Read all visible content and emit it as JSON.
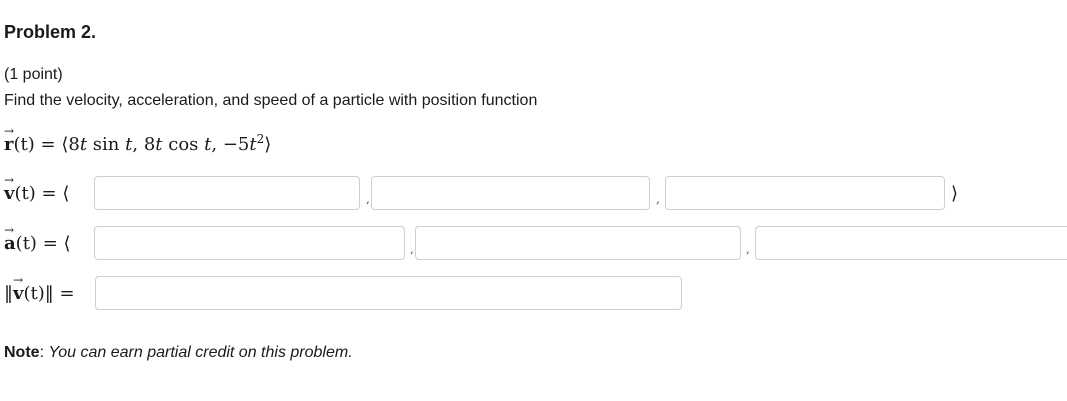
{
  "problem": {
    "title": "Problem 2.",
    "points": "(1 point)",
    "prompt": "Find the velocity, acceleration, and speed of a particle with position function"
  },
  "position": {
    "r": "r",
    "arg": "(t)",
    "eq": "=",
    "open": "⟨",
    "c1_coef": "8",
    "c1_var": "t",
    "c1_fn": "sin",
    "c1_arg": "t",
    "sep": ",",
    "c2_coef": "8",
    "c2_var": "t",
    "c2_fn": "cos",
    "c2_arg": "t",
    "c3_coef": "−5",
    "c3_var": "t",
    "c3_exp": "2",
    "close": "⟩"
  },
  "velocity": {
    "symbol": "v",
    "arg": "(t)",
    "eq": "=",
    "open": "⟨",
    "sep1": ",",
    "sep2": ",",
    "close": "⟩",
    "answers": [
      "",
      "",
      ""
    ]
  },
  "acceleration": {
    "symbol": "a",
    "arg": "(t)",
    "eq": "=",
    "open": "⟨",
    "sep1": ",",
    "sep2": ",",
    "answers": [
      "",
      "",
      ""
    ]
  },
  "speed": {
    "bars_open": "‖",
    "symbol": "v",
    "arg": "(t)",
    "bars_close": "‖",
    "eq": "=",
    "answer": ""
  },
  "note": {
    "label": "Note",
    "colon": ":",
    "text": "You can earn partial credit on this problem."
  }
}
